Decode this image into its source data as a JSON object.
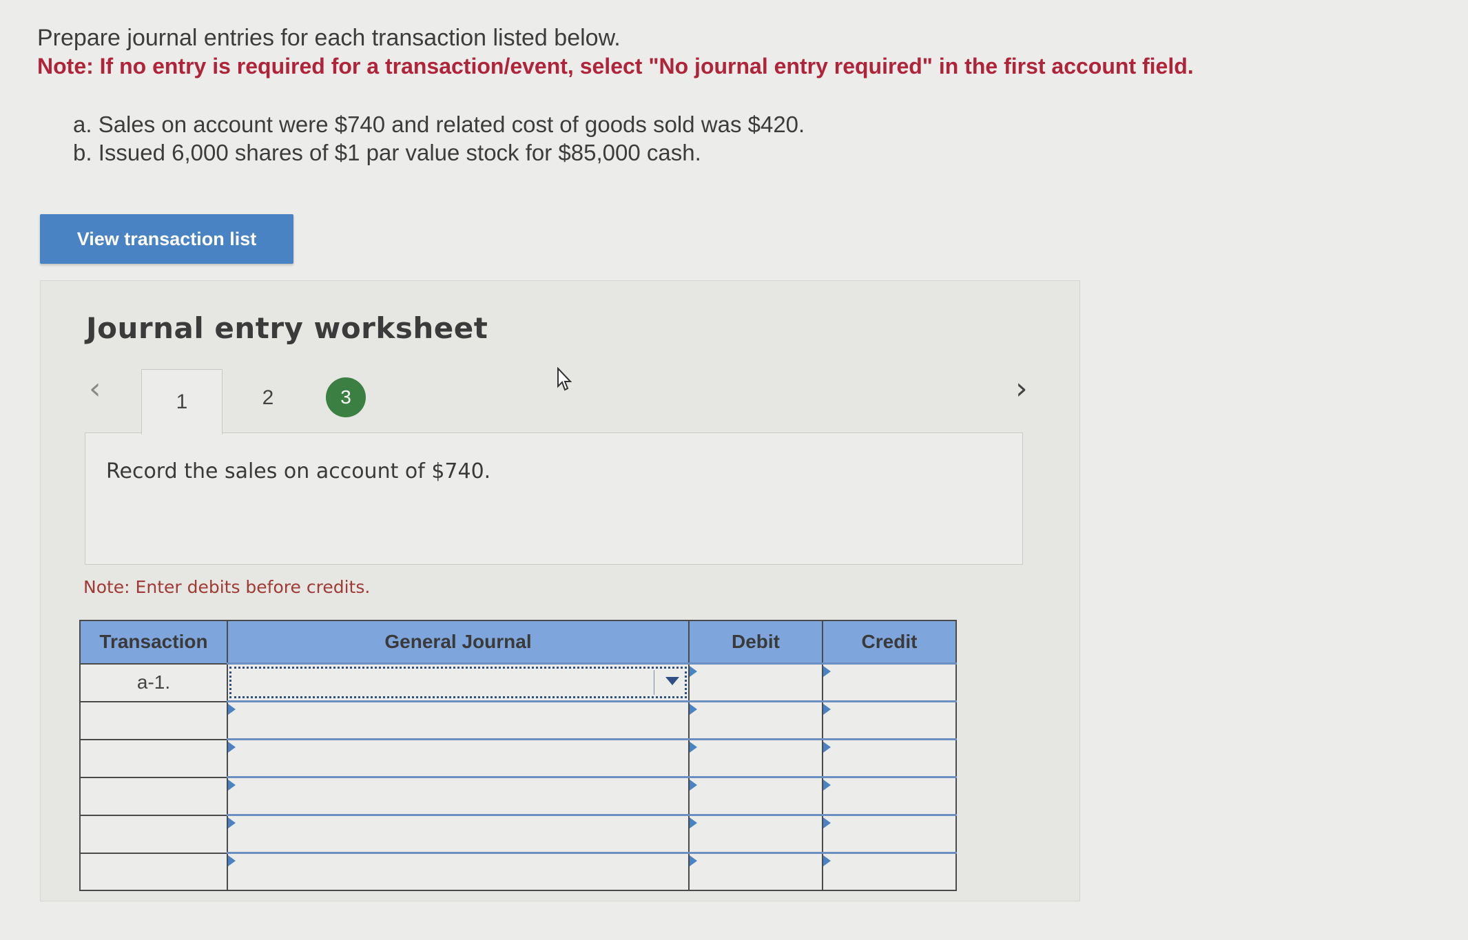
{
  "instructions": {
    "line1": "Prepare journal entries for each transaction listed below.",
    "note": "Note: If no entry is required for a transaction/event, select \"No journal entry required\" in the first account field."
  },
  "transactions": [
    "a. Sales on account were $740 and related cost of goods sold was $420.",
    "b. Issued 6,000 shares of $1 par value stock for $85,000 cash."
  ],
  "view_button_label": "View transaction list",
  "worksheet": {
    "title": "Journal entry worksheet",
    "tabs": [
      "1",
      "2",
      "3"
    ],
    "active_tab": "1",
    "completed_tab": "3",
    "record_prompt": "Record the sales on account of $740.",
    "entry_note": "Note: Enter debits before credits."
  },
  "journal_table": {
    "headers": [
      "Transaction",
      "General Journal",
      "Debit",
      "Credit"
    ],
    "rows": [
      {
        "transaction": "a-1.",
        "account": "",
        "debit": "",
        "credit": ""
      },
      {
        "transaction": "",
        "account": "",
        "debit": "",
        "credit": ""
      },
      {
        "transaction": "",
        "account": "",
        "debit": "",
        "credit": ""
      },
      {
        "transaction": "",
        "account": "",
        "debit": "",
        "credit": ""
      },
      {
        "transaction": "",
        "account": "",
        "debit": "",
        "credit": ""
      },
      {
        "transaction": "",
        "account": "",
        "debit": "",
        "credit": ""
      }
    ]
  },
  "icons": {
    "prev": "chevron-left-icon",
    "next": "chevron-right-icon",
    "dropdown": "caret-down-icon",
    "cursor": "mouse-pointer-icon"
  },
  "colors": {
    "note_red": "#b0243a",
    "button_blue": "#4a83c4",
    "header_blue": "#7fa6dc",
    "completed_green": "#3c7f43"
  }
}
